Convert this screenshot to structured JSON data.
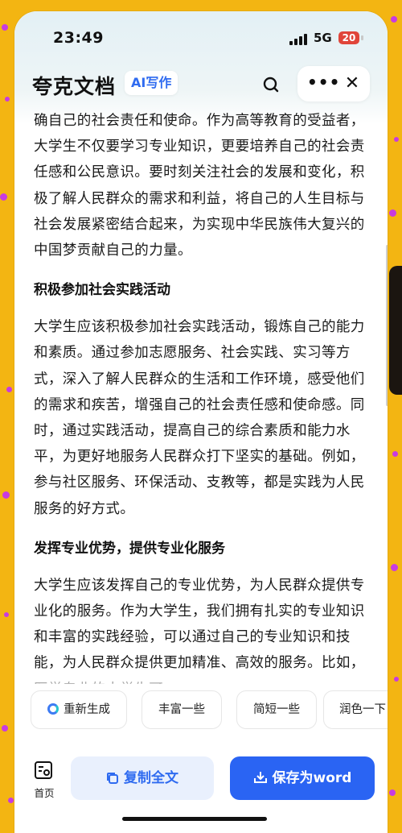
{
  "status_bar": {
    "time": "23:49",
    "network": "5G",
    "battery": "20"
  },
  "header": {
    "title": "夸克文档",
    "ai_badge": "AI写作"
  },
  "content": {
    "blocks": [
      {
        "type": "paragraph",
        "text": "确自己的社会责任和使命。作为高等教育的受益者，大学生不仅要学习专业知识，更要培养自己的社会责任感和公民意识。要时刻关注社会的发展和变化，积极了解人民群众的需求和利益，将自己的人生目标与社会发展紧密结合起来，为实现中华民族伟大复兴的中国梦贡献自己的力量。"
      },
      {
        "type": "heading",
        "text": "积极参加社会实践活动"
      },
      {
        "type": "paragraph",
        "text": "大学生应该积极参加社会实践活动，锻炼自己的能力和素质。通过参加志愿服务、社会实践、实习等方式，深入了解人民群众的生活和工作环境，感受他们的需求和疾苦，增强自己的社会责任感和使命感。同时，通过实践活动，提高自己的综合素质和能力水平，为更好地服务人民群众打下坚实的基础。例如，参与社区服务、环保活动、支教等，都是实践为人民服务的好方式。"
      },
      {
        "type": "heading",
        "text": "发挥专业优势，提供专业化服务"
      },
      {
        "type": "paragraph",
        "text": "大学生应该发挥自己的专业优势，为人民群众提供专业化的服务。作为大学生，我们拥有扎实的专业知识和丰富的实践经验，可以通过自己的专业知识和技能，为人民群众提供更加精准、高效的服务。比如，医学专业的大学生可"
      }
    ]
  },
  "chips": [
    "重新生成",
    "丰富一些",
    "简短一些",
    "润色一下"
  ],
  "bottom_bar": {
    "home_label": "首页",
    "copy_label": "复制全文",
    "save_label": "保存为word"
  },
  "colors": {
    "accent": "#2a64f3",
    "accent_light": "#e9f0fd",
    "background": "#f3b512",
    "decor": "#c83be0"
  }
}
